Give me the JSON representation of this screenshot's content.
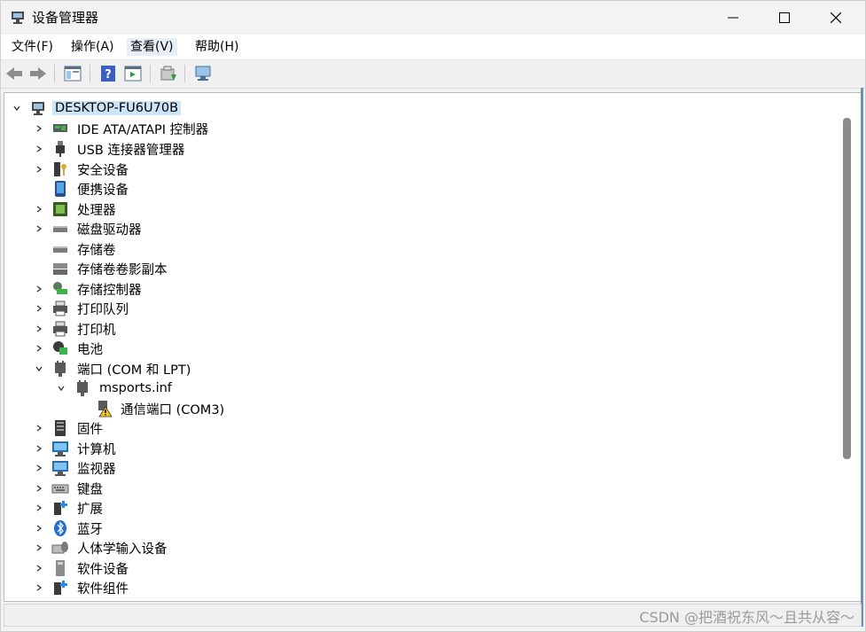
{
  "window": {
    "title": "设备管理器"
  },
  "menu": [
    {
      "label": "文件(F)"
    },
    {
      "label": "操作(A)"
    },
    {
      "label": "查看(V)"
    },
    {
      "label": "帮助(H)"
    }
  ],
  "tree": {
    "root": "DESKTOP-FU6U70B",
    "categories": [
      {
        "label": "IDE ATA/ATAPI 控制器",
        "icon": "ide-controller-icon"
      },
      {
        "label": "USB 连接器管理器",
        "icon": "usb-icon"
      },
      {
        "label": "安全设备",
        "icon": "security-device-icon"
      },
      {
        "label": "便携设备",
        "icon": "portable-device-icon"
      },
      {
        "label": "处理器",
        "icon": "processor-icon"
      },
      {
        "label": "磁盘驱动器",
        "icon": "disk-drive-icon"
      },
      {
        "label": "存储卷",
        "icon": "storage-volume-icon"
      },
      {
        "label": "存储卷卷影副本",
        "icon": "shadow-copy-icon"
      },
      {
        "label": "存储控制器",
        "icon": "storage-controller-icon"
      },
      {
        "label": "打印队列",
        "icon": "print-queue-icon"
      },
      {
        "label": "打印机",
        "icon": "printer-icon"
      },
      {
        "label": "电池",
        "icon": "battery-icon"
      },
      {
        "label": "端口 (COM 和 LPT)",
        "icon": "port-icon"
      },
      {
        "label": "msports.inf",
        "icon": "port-icon"
      },
      {
        "label": "通信端口 (COM3)",
        "icon": "warning-port-icon"
      },
      {
        "label": "固件",
        "icon": "firmware-icon"
      },
      {
        "label": "计算机",
        "icon": "computer-icon"
      },
      {
        "label": "监视器",
        "icon": "monitor-icon"
      },
      {
        "label": "键盘",
        "icon": "keyboard-icon"
      },
      {
        "label": "扩展",
        "icon": "extension-icon"
      },
      {
        "label": "蓝牙",
        "icon": "bluetooth-icon"
      },
      {
        "label": "人体学输入设备",
        "icon": "hid-icon"
      },
      {
        "label": "软件设备",
        "icon": "software-device-icon"
      },
      {
        "label": "软件组件",
        "icon": "software-component-icon"
      }
    ]
  },
  "watermark": "CSDN @把酒祝东风～且共从容～",
  "colors": {
    "selection": "#cce4f7",
    "accent": "#6e8fb8",
    "scroll_thumb": "#8a8a8a"
  }
}
